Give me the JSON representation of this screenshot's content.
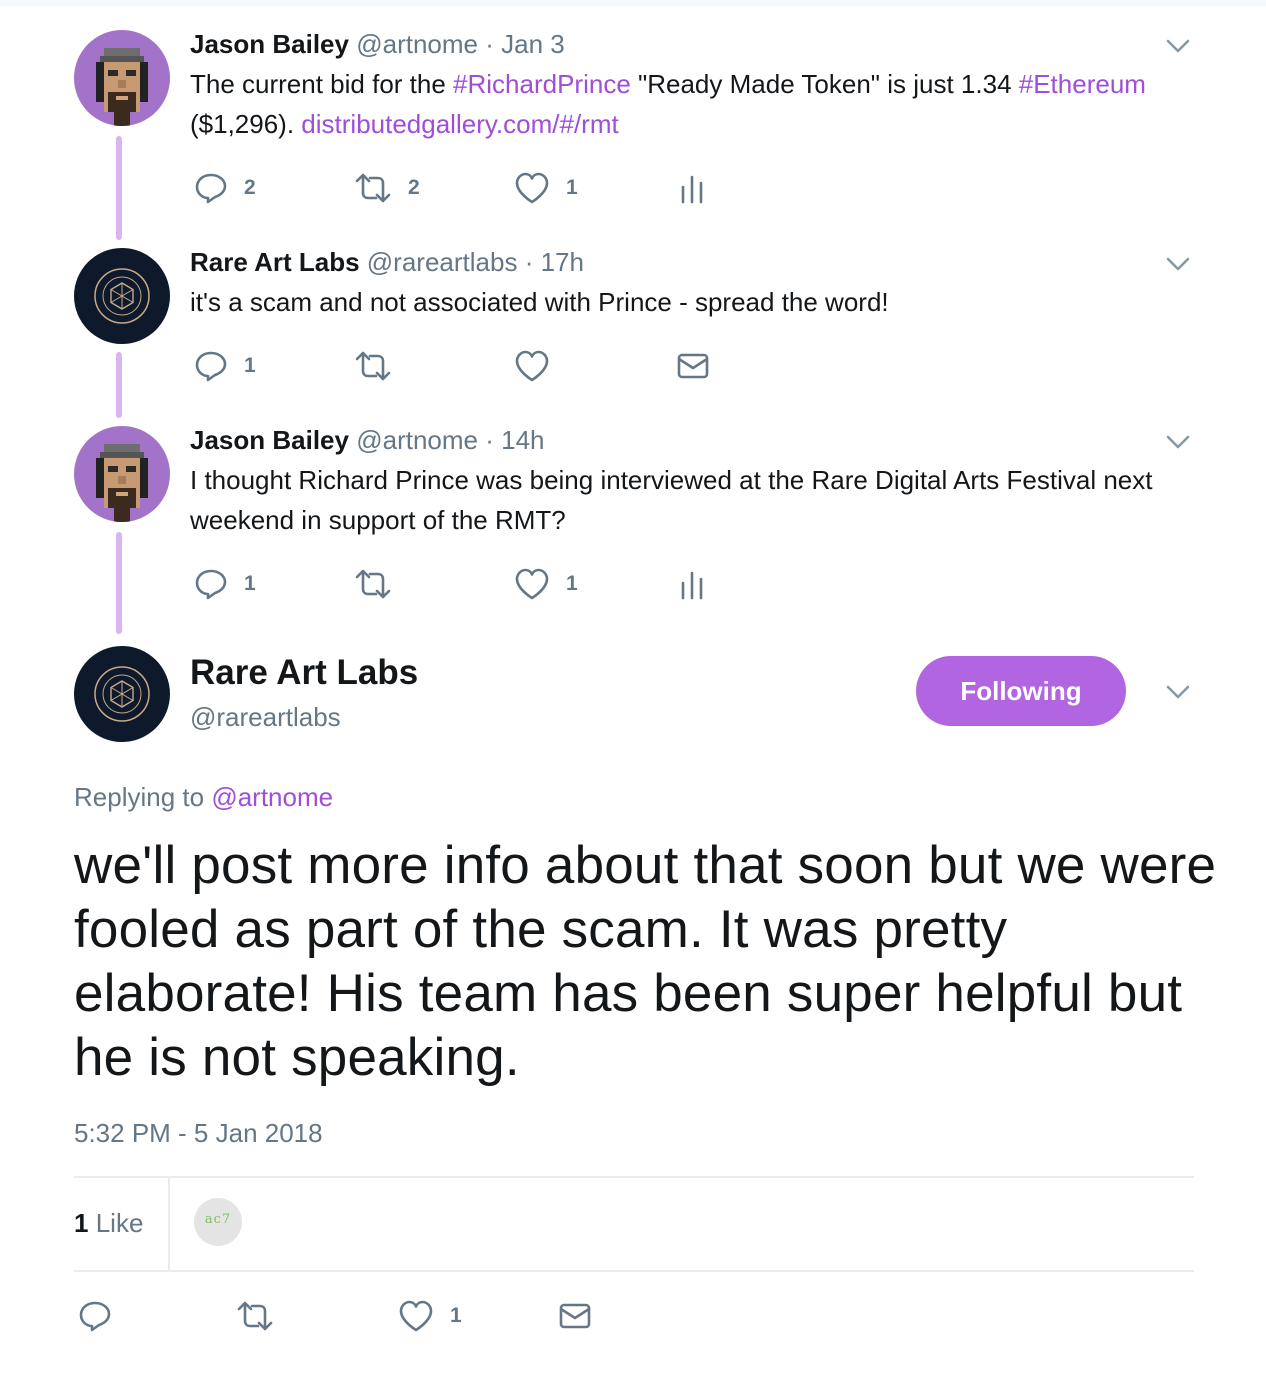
{
  "colors": {
    "accent": "#9f4ed8",
    "thread_line": "#d8b5ee",
    "button": "#b265e0",
    "muted": "#657786",
    "icon": "#657786"
  },
  "tweets": [
    {
      "name": "Jason Bailey",
      "handle": "@artnome",
      "sep": "·",
      "time": "Jan 3",
      "text": {
        "p1": "The current bid for the ",
        "l1": "#RichardPrince",
        "p2": " \"Ready Made Token\" is just 1.34 ",
        "l2": "#Ethereum",
        "p3": " ($1,296). ",
        "l3": "distributedgallery.com/#/rmt"
      },
      "counts": {
        "reply": "2",
        "retweet": "2",
        "like": "1"
      },
      "third_action_icon": "analytics-icon"
    },
    {
      "name": "Rare Art Labs",
      "handle": "@rareartlabs",
      "sep": "·",
      "time": "17h",
      "text": {
        "p1": "it's a scam and not associated with Prince - spread the word!"
      },
      "counts": {
        "reply": "1",
        "retweet": "",
        "like": ""
      },
      "third_action_icon": "envelope-icon"
    },
    {
      "name": "Jason Bailey",
      "handle": "@artnome",
      "sep": "·",
      "time": "14h",
      "text": {
        "p1": "I thought Richard Prince was being interviewed at the Rare Digital Arts Festival next weekend in support of the RMT?"
      },
      "counts": {
        "reply": "1",
        "retweet": "",
        "like": "1"
      },
      "third_action_icon": "analytics-icon"
    }
  ],
  "main": {
    "name": "Rare Art Labs",
    "handle": "@rareartlabs",
    "follow_label": "Following",
    "replying_prefix": "Replying to ",
    "replying_to": "@artnome",
    "text": "we'll post more info about that soon but we were fooled as part of the scam. It was pretty elaborate! His team has been super helpful but he is not speaking.",
    "timestamp": "5:32 PM - 5 Jan 2018",
    "likes_count": "1",
    "likes_label": "Like",
    "liker_initials": "ac7",
    "counts": {
      "reply": "",
      "retweet": "",
      "like": "1"
    }
  }
}
